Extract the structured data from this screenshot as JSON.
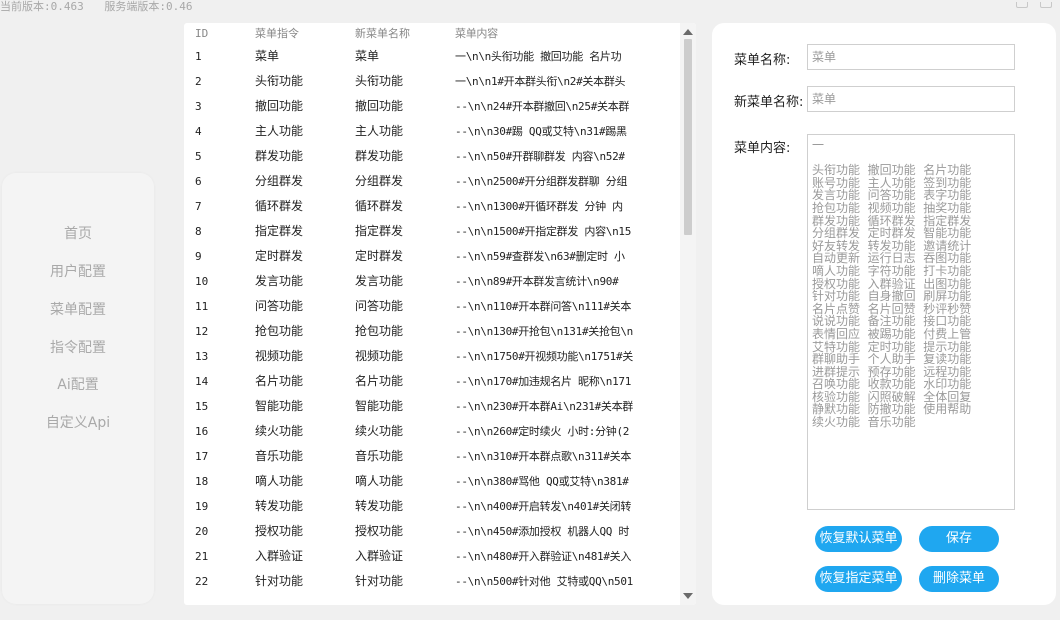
{
  "header": {
    "client_version": "当前版本:0.463",
    "server_version": "服务端版本:0.46"
  },
  "sidebar": {
    "items": [
      {
        "label": "首页"
      },
      {
        "label": "用户配置"
      },
      {
        "label": "菜单配置"
      },
      {
        "label": "指令配置"
      },
      {
        "label": "Ai配置"
      },
      {
        "label": "自定义Api"
      }
    ]
  },
  "table": {
    "columns": {
      "id": "ID",
      "command": "菜单指令",
      "new_name": "新菜单名称",
      "content": "菜单内容"
    },
    "rows": [
      {
        "id": "1",
        "command": "菜单",
        "new_name": "菜单",
        "content": "一\\n\\n头衔功能 撤回功能 名片功"
      },
      {
        "id": "2",
        "command": "头衔功能",
        "new_name": "头衔功能",
        "content": "一\\n\\n1#开本群头衔\\n2#关本群头"
      },
      {
        "id": "3",
        "command": "撤回功能",
        "new_name": "撤回功能",
        "content": "--\\n\\n24#开本群撤回\\n25#关本群"
      },
      {
        "id": "4",
        "command": "主人功能",
        "new_name": "主人功能",
        "content": "--\\n\\n30#踢 QQ或艾特\\n31#踢黑"
      },
      {
        "id": "5",
        "command": "群发功能",
        "new_name": "群发功能",
        "content": "--\\n\\n50#开群聊群发 内容\\n52#"
      },
      {
        "id": "6",
        "command": "分组群发",
        "new_name": "分组群发",
        "content": "--\\n\\n2500#开分组群发群聊 分组"
      },
      {
        "id": "7",
        "command": "循环群发",
        "new_name": "循环群发",
        "content": "--\\n\\n1300#开循环群发 分钟 内"
      },
      {
        "id": "8",
        "command": "指定群发",
        "new_name": "指定群发",
        "content": "--\\n\\n1500#开指定群发 内容\\n15"
      },
      {
        "id": "9",
        "command": "定时群发",
        "new_name": "定时群发",
        "content": "--\\n\\n59#查群发\\n63#删定时 小"
      },
      {
        "id": "10",
        "command": "发言功能",
        "new_name": "发言功能",
        "content": "--\\n\\n89#开本群发言统计\\n90#"
      },
      {
        "id": "11",
        "command": "问答功能",
        "new_name": "问答功能",
        "content": "--\\n\\n110#开本群问答\\n111#关本"
      },
      {
        "id": "12",
        "command": "抢包功能",
        "new_name": "抢包功能",
        "content": "--\\n\\n130#开抢包\\n131#关抢包\\n"
      },
      {
        "id": "13",
        "command": "视频功能",
        "new_name": "视频功能",
        "content": "--\\n\\n1750#开视频功能\\n1751#关"
      },
      {
        "id": "14",
        "command": "名片功能",
        "new_name": "名片功能",
        "content": "--\\n\\n170#加违规名片 昵称\\n171"
      },
      {
        "id": "15",
        "command": "智能功能",
        "new_name": "智能功能",
        "content": "--\\n\\n230#开本群Ai\\n231#关本群"
      },
      {
        "id": "16",
        "command": "续火功能",
        "new_name": "续火功能",
        "content": "--\\n\\n260#定时续火 小时:分钟(2"
      },
      {
        "id": "17",
        "command": "音乐功能",
        "new_name": "音乐功能",
        "content": "--\\n\\n310#开本群点歌\\n311#关本"
      },
      {
        "id": "18",
        "command": "嘀人功能",
        "new_name": "嘀人功能",
        "content": "--\\n\\n380#骂他 QQ或艾特\\n381#"
      },
      {
        "id": "19",
        "command": "转发功能",
        "new_name": "转发功能",
        "content": "--\\n\\n400#开启转发\\n401#关闭转"
      },
      {
        "id": "20",
        "command": "授权功能",
        "new_name": "授权功能",
        "content": "--\\n\\n450#添加授权 机器人QQ 时"
      },
      {
        "id": "21",
        "command": "入群验证",
        "new_name": "入群验证",
        "content": "--\\n\\n480#开入群验证\\n481#关入"
      },
      {
        "id": "22",
        "command": "针对功能",
        "new_name": "针对功能",
        "content": "--\\n\\n500#针对他 艾特或QQ\\n501"
      }
    ]
  },
  "editor": {
    "menu_name_label": "菜单名称:",
    "menu_name_value": "菜单",
    "new_menu_name_label": "新菜单名称:",
    "new_menu_name_value": "菜单",
    "menu_content_label": "菜单内容:",
    "menu_content_lines": [
      "一",
      "",
      "头衔功能  撤回功能  名片功能",
      "账号功能  主人功能  签到功能",
      "发言功能  问答功能  表字功能",
      "抢包功能  视频功能  抽奖功能",
      "群发功能  循环群发  指定群发",
      "分组群发  定时群发  智能功能",
      "好友转发  转发功能  邀请统计",
      "自动更新  运行日志  吞图功能",
      "嘀人功能  字符功能  打卡功能",
      "授权功能  入群验证  出图功能",
      "针对功能  自身撤回  刷屏功能",
      "名片点赞  名片回赞  秒评秒赞",
      "说说功能  备注功能  接口功能",
      "表情回应  被踢功能  付费上管",
      "艾特功能  定时功能  提示功能",
      "群聊助手  个人助手  复读功能",
      "进群提示  预存功能  远程功能",
      "召唤功能  收款功能  水印功能",
      "核验功能  闪照破解  全体回复",
      "静默功能  防撤功能  使用帮助",
      "续火功能  音乐功能"
    ],
    "buttons": {
      "restore_default": "恢复默认菜单",
      "save": "保存",
      "restore_specified": "恢复指定菜单",
      "delete": "删除菜单"
    }
  },
  "colors": {
    "accent_button": "#1fa7f0",
    "sidebar_text": "#a9a9a9",
    "page_background": "#f0f0f0"
  }
}
